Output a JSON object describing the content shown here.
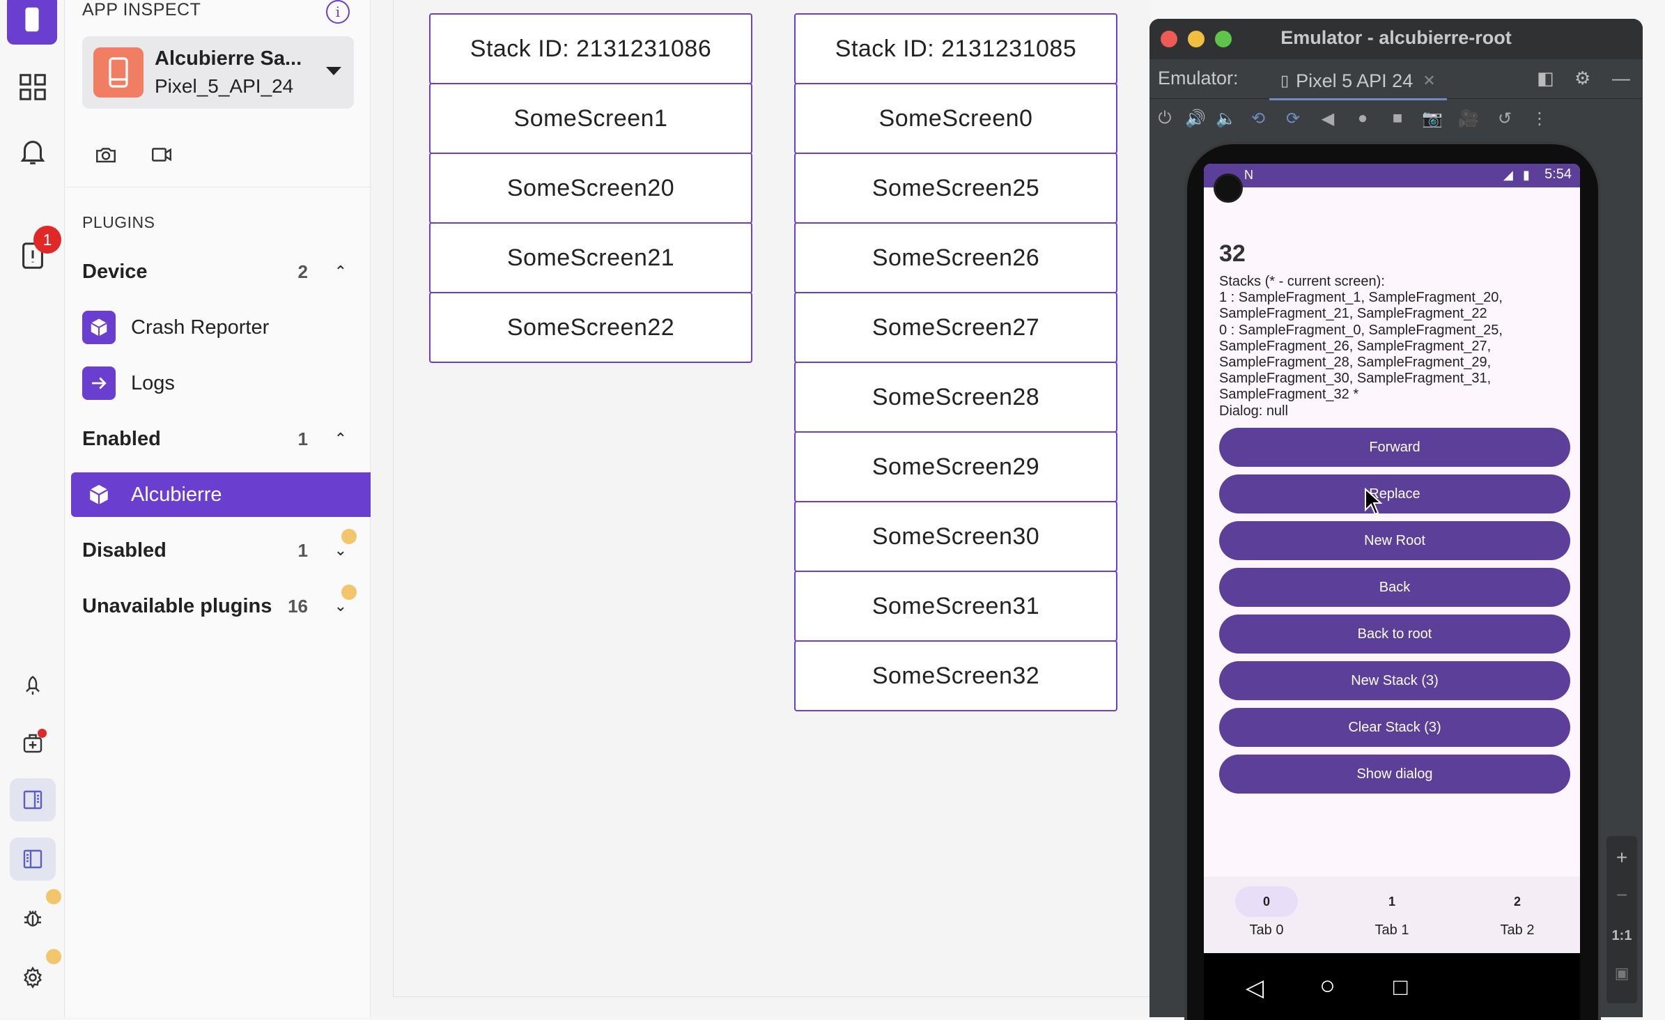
{
  "sidebar": {
    "header": "APP INSPECT",
    "device": {
      "name": "Alcubierre Sa...",
      "model": "Pixel_5_API_24"
    },
    "plugins_label": "PLUGINS",
    "groups": [
      {
        "label": "Device",
        "count": "2"
      },
      {
        "label": "Enabled",
        "count": "1"
      },
      {
        "label": "Disabled",
        "count": "1"
      },
      {
        "label": "Unavailable plugins",
        "count": "16"
      }
    ],
    "device_plugins": [
      {
        "label": "Crash Reporter",
        "icon": "box-icon"
      },
      {
        "label": "Logs",
        "icon": "arrow-right-icon"
      }
    ],
    "enabled_plugins": [
      {
        "label": "Alcubierre",
        "icon": "box-icon"
      }
    ]
  },
  "rail": {
    "alert_badge": "1"
  },
  "stacks": [
    {
      "header": "Stack ID: 2131231086",
      "screens": [
        "SomeScreen1",
        "SomeScreen20",
        "SomeScreen21",
        "SomeScreen22"
      ]
    },
    {
      "header": "Stack ID: 2131231085",
      "screens": [
        "SomeScreen0",
        "SomeScreen25",
        "SomeScreen26",
        "SomeScreen27",
        "SomeScreen28",
        "SomeScreen29",
        "SomeScreen30",
        "SomeScreen31",
        "SomeScreen32"
      ]
    }
  ],
  "emulator": {
    "title": "Emulator - alcubierre-root",
    "label": "Emulator:",
    "tab": "Pixel 5 API 24",
    "zoom_label": "1:1"
  },
  "phone": {
    "clock": "5:54",
    "counter": "32",
    "stacks_text": [
      "Stacks (* - current screen):",
      "1 : SampleFragment_1, SampleFragment_20,",
      "SampleFragment_21, SampleFragment_22",
      "0 : SampleFragment_0, SampleFragment_25,",
      "SampleFragment_26, SampleFragment_27,",
      "SampleFragment_28, SampleFragment_29,",
      "SampleFragment_30, SampleFragment_31,",
      "SampleFragment_32 *",
      "Dialog: null"
    ],
    "buttons": [
      "Forward",
      "Replace",
      "New Root",
      "Back",
      "Back to root",
      "New Stack (3)",
      "Clear Stack (3)",
      "Show dialog"
    ],
    "tabs": [
      {
        "num": "0",
        "label": "Tab 0"
      },
      {
        "num": "1",
        "label": "Tab 1"
      },
      {
        "num": "2",
        "label": "Tab 2"
      }
    ]
  },
  "colors": {
    "accent": "#6a3fd0",
    "phone_primary": "#5b3f99",
    "badge": "#e02828",
    "warn_dot": "#f2c66d"
  }
}
